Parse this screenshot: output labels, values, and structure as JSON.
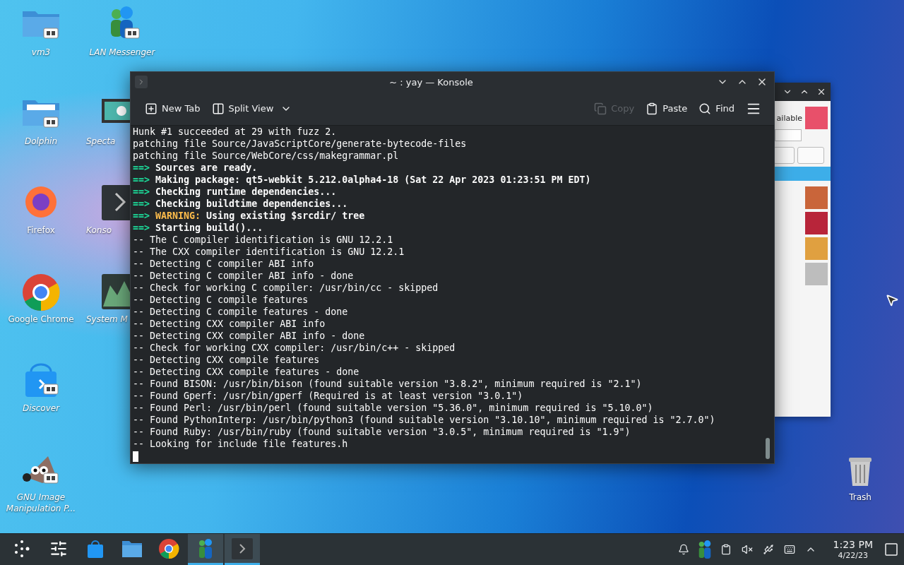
{
  "desktop_icons": [
    {
      "label": "vm3",
      "kind": "folder",
      "link": true
    },
    {
      "label": "LAN Messenger",
      "kind": "messenger",
      "link": true
    },
    {
      "label": "Dolphin",
      "kind": "dolphin",
      "link": true
    },
    {
      "label": "Specta",
      "kind": "spectacle",
      "link": false
    },
    {
      "label": "Firefox",
      "kind": "firefox",
      "link": false
    },
    {
      "label": "Konso",
      "kind": "konsole",
      "link": false
    },
    {
      "label": "Google Chrome",
      "kind": "chrome",
      "link": false
    },
    {
      "label": "System M",
      "kind": "monitor",
      "link": false
    },
    {
      "label": "Discover",
      "kind": "discover",
      "link": true
    },
    {
      "label": "GNU Image Manipulation P...",
      "kind": "gimp",
      "link": true
    },
    {
      "label": "Trash",
      "kind": "trash",
      "link": false
    }
  ],
  "back_window": {
    "partial_label": "ailable",
    "rows": [
      {
        "selected": true,
        "thumb": false
      },
      {
        "selected": false,
        "thumb": true
      },
      {
        "selected": false,
        "thumb": true
      },
      {
        "selected": false,
        "thumb": true
      },
      {
        "selected": false,
        "thumb": true
      }
    ]
  },
  "window": {
    "title": "~ : yay — Konsole",
    "toolbar_left": [
      {
        "label": "New Tab",
        "kind": "newtab",
        "disabled": false
      },
      {
        "label": "Split View",
        "kind": "split",
        "disabled": false
      }
    ],
    "toolbar_right": [
      {
        "label": "Copy",
        "kind": "copy",
        "disabled": true
      },
      {
        "label": "Paste",
        "kind": "paste",
        "disabled": false
      },
      {
        "label": "Find",
        "kind": "find",
        "disabled": false
      }
    ],
    "lines": [
      {
        "kind": "plain",
        "text": "Hunk #1 succeeded at 29 with fuzz 2."
      },
      {
        "kind": "plain",
        "text": "patching file Source/JavaScriptCore/generate-bytecode-files"
      },
      {
        "kind": "plain",
        "text": "patching file Source/WebCore/css/makegrammar.pl"
      },
      {
        "kind": "step",
        "prefix": "==>",
        "text": "Sources are ready."
      },
      {
        "kind": "step",
        "prefix": "==>",
        "text": "Making package: qt5-webkit 5.212.0alpha4-18 (Sat 22 Apr 2023 01:23:51 PM EDT)"
      },
      {
        "kind": "step",
        "prefix": "==>",
        "text": "Checking runtime dependencies..."
      },
      {
        "kind": "step",
        "prefix": "==>",
        "text": "Checking buildtime dependencies..."
      },
      {
        "kind": "warning",
        "prefix": "==>",
        "label": "WARNING:",
        "text": "Using existing $srcdir/ tree"
      },
      {
        "kind": "step",
        "prefix": "==>",
        "text": "Starting build()..."
      },
      {
        "kind": "plain",
        "text": "-- The C compiler identification is GNU 12.2.1"
      },
      {
        "kind": "plain",
        "text": "-- The CXX compiler identification is GNU 12.2.1"
      },
      {
        "kind": "plain",
        "text": "-- Detecting C compiler ABI info"
      },
      {
        "kind": "plain",
        "text": "-- Detecting C compiler ABI info - done"
      },
      {
        "kind": "plain",
        "text": "-- Check for working C compiler: /usr/bin/cc - skipped"
      },
      {
        "kind": "plain",
        "text": "-- Detecting C compile features"
      },
      {
        "kind": "plain",
        "text": "-- Detecting C compile features - done"
      },
      {
        "kind": "plain",
        "text": "-- Detecting CXX compiler ABI info"
      },
      {
        "kind": "plain",
        "text": "-- Detecting CXX compiler ABI info - done"
      },
      {
        "kind": "plain",
        "text": "-- Check for working CXX compiler: /usr/bin/c++ - skipped"
      },
      {
        "kind": "plain",
        "text": "-- Detecting CXX compile features"
      },
      {
        "kind": "plain",
        "text": "-- Detecting CXX compile features - done"
      },
      {
        "kind": "plain",
        "text": "-- Found BISON: /usr/bin/bison (found suitable version \"3.8.2\", minimum required is \"2.1\")"
      },
      {
        "kind": "plain",
        "text": "-- Found Gperf: /usr/bin/gperf (Required is at least version \"3.0.1\")"
      },
      {
        "kind": "plain",
        "text": "-- Found Perl: /usr/bin/perl (found suitable version \"5.36.0\", minimum required is \"5.10.0\")"
      },
      {
        "kind": "plain",
        "text": "-- Found PythonInterp: /usr/bin/python3 (found suitable version \"3.10.10\", minimum required is \"2.7.0\")"
      },
      {
        "kind": "plain",
        "text": "-- Found Ruby: /usr/bin/ruby (found suitable version \"3.0.5\", minimum required is \"1.9\")"
      },
      {
        "kind": "plain",
        "text": "-- Looking for include file features.h"
      }
    ]
  },
  "taskbar": {
    "items": [
      {
        "kind": "launcher",
        "active": false
      },
      {
        "kind": "settings",
        "active": false
      },
      {
        "kind": "discover",
        "active": false
      },
      {
        "kind": "folder",
        "active": false
      },
      {
        "kind": "chrome",
        "active": false
      },
      {
        "kind": "messenger",
        "active": true
      },
      {
        "kind": "konsole",
        "active": true
      }
    ],
    "tray": [
      {
        "kind": "bell"
      },
      {
        "kind": "messenger"
      },
      {
        "kind": "clipboard"
      },
      {
        "kind": "muted"
      },
      {
        "kind": "usb"
      },
      {
        "kind": "input"
      },
      {
        "kind": "expand"
      }
    ],
    "time": "1:23 PM",
    "date": "4/22/23"
  }
}
